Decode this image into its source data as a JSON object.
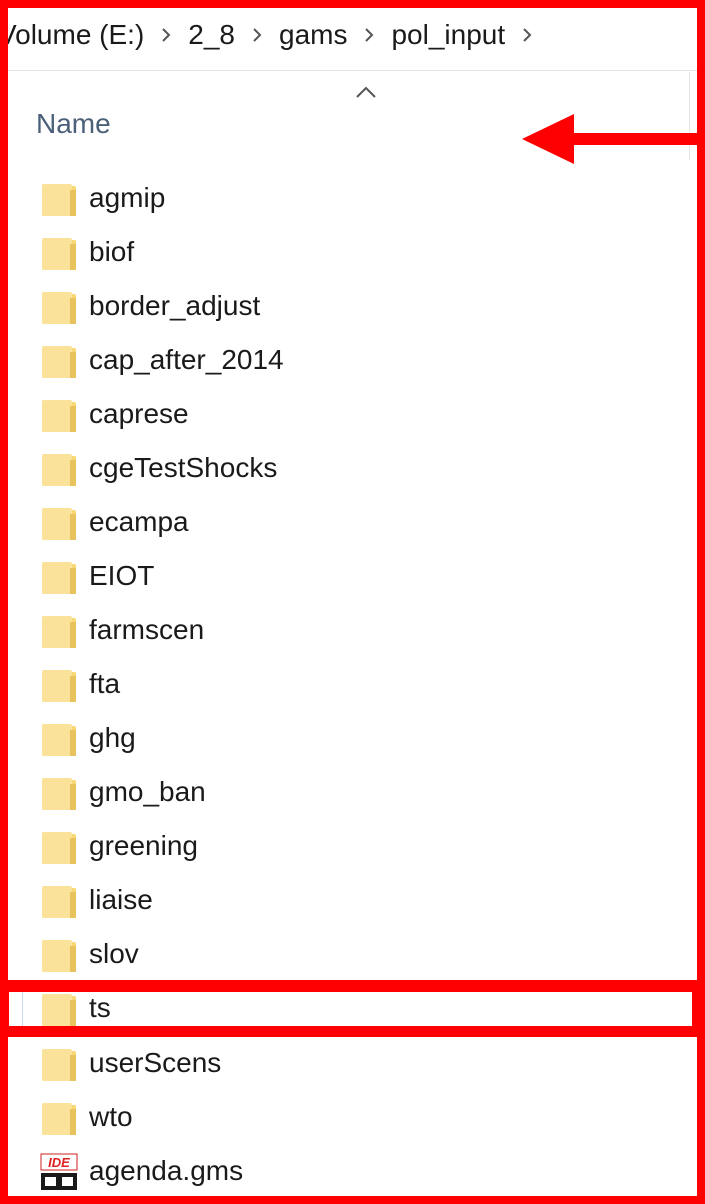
{
  "breadcrumb": {
    "items": [
      "Volume (E:)",
      "2_8",
      "gams",
      "pol_input"
    ]
  },
  "column_header": {
    "name_label": "Name",
    "sort": "ascending"
  },
  "files": [
    {
      "name": "agmip",
      "type": "folder"
    },
    {
      "name": "biof",
      "type": "folder"
    },
    {
      "name": "border_adjust",
      "type": "folder"
    },
    {
      "name": "cap_after_2014",
      "type": "folder"
    },
    {
      "name": "caprese",
      "type": "folder"
    },
    {
      "name": "cgeTestShocks",
      "type": "folder"
    },
    {
      "name": "ecampa",
      "type": "folder"
    },
    {
      "name": "EIOT",
      "type": "folder"
    },
    {
      "name": "farmscen",
      "type": "folder"
    },
    {
      "name": "fta",
      "type": "folder"
    },
    {
      "name": "ghg",
      "type": "folder"
    },
    {
      "name": "gmo_ban",
      "type": "folder"
    },
    {
      "name": "greening",
      "type": "folder"
    },
    {
      "name": "liaise",
      "type": "folder"
    },
    {
      "name": "slov",
      "type": "folder"
    },
    {
      "name": "ts",
      "type": "folder",
      "focused": true
    },
    {
      "name": "userScens",
      "type": "folder"
    },
    {
      "name": "wto",
      "type": "folder"
    },
    {
      "name": "agenda.gms",
      "type": "gams-file",
      "icon_text": "IDE"
    }
  ],
  "colors": {
    "highlight": "#ff0000",
    "folder": "#f8d775",
    "header_text": "#4c607a"
  }
}
